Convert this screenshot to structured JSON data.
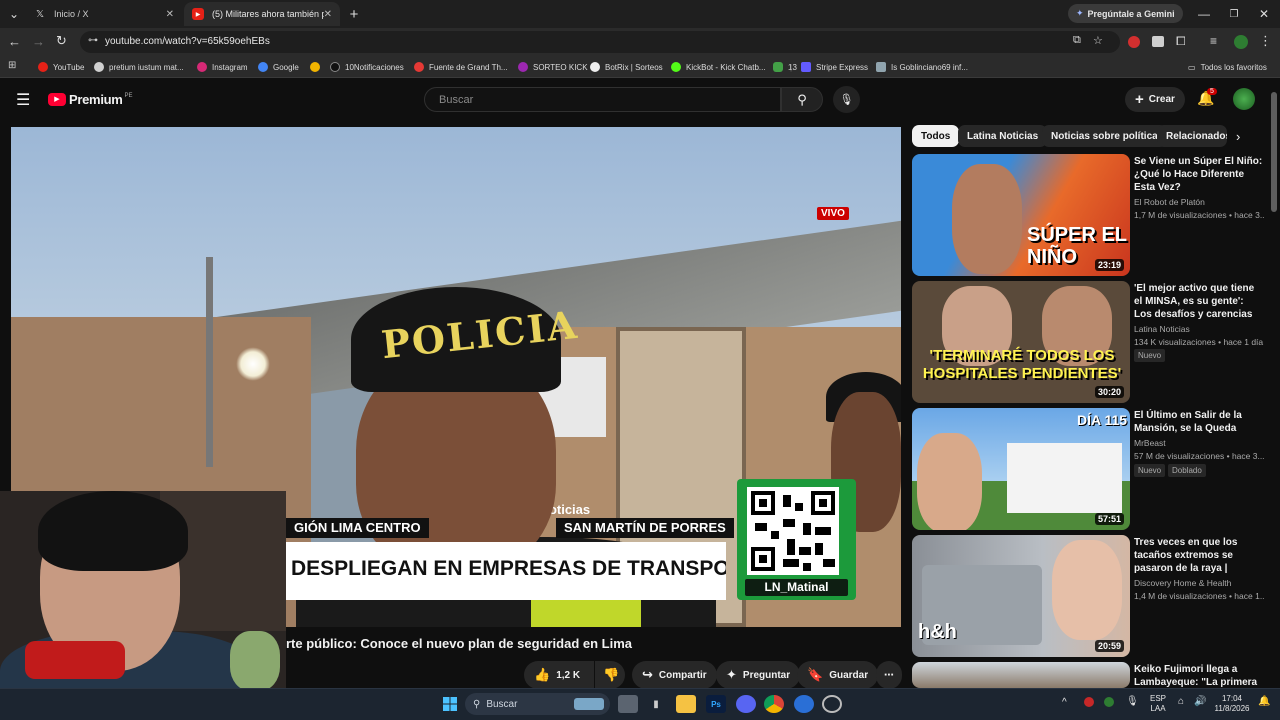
{
  "browser": {
    "tabs": [
      {
        "title": "Inicio / X",
        "active": false
      },
      {
        "title": "(5) Militares ahora también pro",
        "active": true
      }
    ],
    "new_tab": "+",
    "gemini_button": "Pregúntale a Gemini",
    "url": "youtube.com/watch?v=65k59oehEBs",
    "bookmarks": [
      {
        "label": "YouTube",
        "color": "#e62117"
      },
      {
        "label": "pretium iustum mat...",
        "color": "#d0d0d0"
      },
      {
        "label": "Instagram",
        "color": "#d62976"
      },
      {
        "label": "Google",
        "color": "#4285f4"
      },
      {
        "label": "",
        "color": "#f2b400"
      },
      {
        "label": "10Notificaciones",
        "color": "#000000"
      },
      {
        "label": "Fuente de Grand Th...",
        "color": "#e53935"
      },
      {
        "label": "SORTEO KICK",
        "color": "#9c27b0"
      },
      {
        "label": "BotRix | Sorteos",
        "color": "#eeeeee"
      },
      {
        "label": "KickBot - Kick Chatb...",
        "color": "#53fc18"
      },
      {
        "label": "13",
        "color": "#43a047"
      },
      {
        "label": "|",
        "color": "#2b2b2b"
      },
      {
        "label": "Stripe Express",
        "color": "#635bff"
      },
      {
        "label": "Is Goblinciano69 inf...",
        "color": "#90a4ae"
      }
    ],
    "all_bookmarks": "Todos los favoritos"
  },
  "youtube": {
    "logo": "Premium",
    "region": "PE",
    "search_placeholder": "Buscar",
    "create_label": "Crear",
    "notif_count": "5"
  },
  "video": {
    "live_tag": "VIVO",
    "cap_text": "POLICIA",
    "vest_text": "noticias",
    "location_left": "GIÓN LIMA CENTRO",
    "location_right": "SAN MARTÍN DE PORRES",
    "headline": "DESPLIEGAN EN EMPRESAS DE TRANSPORTE",
    "qr_label": "LN_Matinal",
    "title": "rte público: Conoce el nuevo plan de seguridad en Lima",
    "likes": "1,2 K",
    "actions": {
      "share": "Compartir",
      "ask": "Preguntar",
      "save": "Guardar"
    }
  },
  "sidebar": {
    "chips": [
      "Todos",
      "Latina Noticias",
      "Noticias sobre política",
      "Relacionados"
    ],
    "videos": [
      {
        "title": "Se Viene un Súper El Niño: ¿Qué lo Hace Diferente Esta Vez?",
        "channel": "El Robot de Platón",
        "meta": "1,7 M de visualizaciones • hace 3...",
        "duration": "23:19",
        "thumb_text": "SÚPER EL NIÑO",
        "badge": ""
      },
      {
        "title": "'El mejor activo que tiene el MINSA, es su gente': Los desafíos y carencias del ...",
        "channel": "Latina Noticias",
        "meta": "134 K visualizaciones • hace 1 día",
        "duration": "30:20",
        "thumb_text": "'TERMINARÉ TODOS LOS HOSPITALES PENDIENTES'",
        "badge": "Nuevo"
      },
      {
        "title": "El Último en Salir de la Mansión, se la Queda",
        "channel": "MrBeast",
        "meta": "57 M de visualizaciones • hace 3...",
        "duration": "57:51",
        "thumb_text": "DÍA 115",
        "badge": "Nuevo",
        "badge2": "Doblado"
      },
      {
        "title": "Tres veces en que los tacaños extremos se pasaron de la raya | Tacaños Extremos",
        "channel": "Discovery Home & Health",
        "meta": "1,4 M de visualizaciones • hace 1...",
        "duration": "20:59",
        "thumb_text": "h&h",
        "badge": ""
      },
      {
        "title": "Keiko Fujimori llega a Lambayeque: \"La primera vez",
        "channel": "",
        "meta": "",
        "duration": "",
        "thumb_text": "",
        "badge": ""
      }
    ]
  },
  "taskbar": {
    "search": "Buscar",
    "lang": "ESP",
    "lang2": "LAA",
    "time": "17:04",
    "date": "11/8/2026"
  }
}
